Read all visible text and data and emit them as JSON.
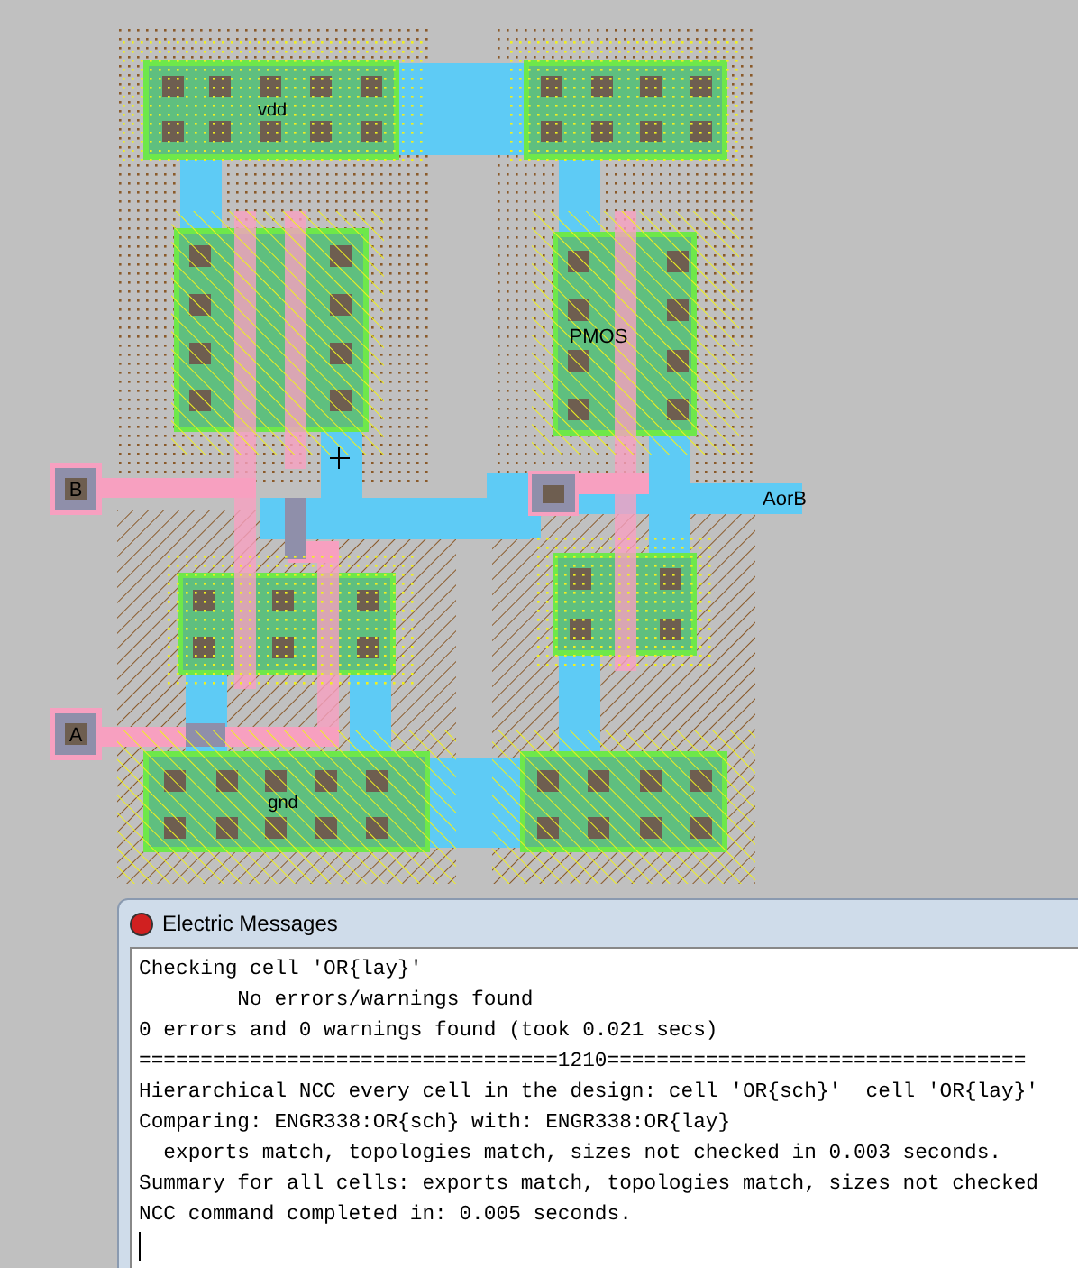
{
  "layout": {
    "vdd_label": "vdd",
    "pmos_label": "PMOS",
    "pin_b": "B",
    "pin_a": "A",
    "output_label": "AorB",
    "gnd_label": "gnd"
  },
  "messages": {
    "title": "Electric Messages",
    "lines": [
      "Checking cell 'OR{lay}'",
      "        No errors/warnings found",
      "0 errors and 0 warnings found (took 0.021 secs)",
      "==================================1210==================================",
      "Hierarchical NCC every cell in the design: cell 'OR{sch}'  cell 'OR{lay}'",
      "Comparing: ENGR338:OR{sch} with: ENGR338:OR{lay}",
      "  exports match, topologies match, sizes not checked in 0.003 seconds.",
      "Summary for all cells: exports match, topologies match, sizes not checked",
      "NCC command completed in: 0.005 seconds."
    ]
  }
}
